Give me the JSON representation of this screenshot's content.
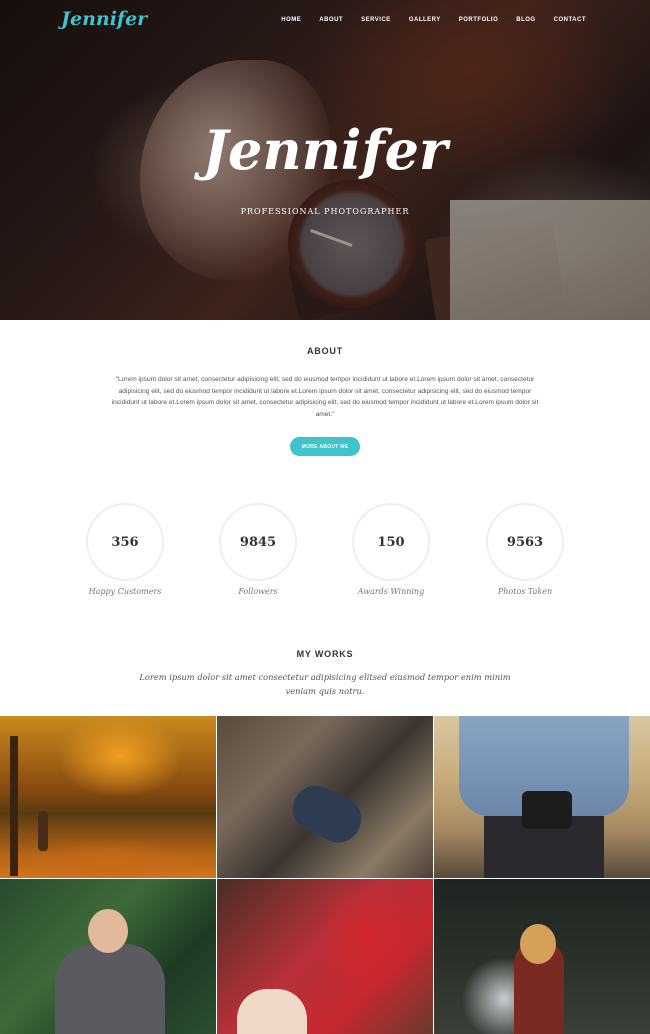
{
  "header": {
    "brand": "Jennifer",
    "nav": [
      "HOME",
      "ABOUT",
      "SERVICE",
      "GALLERY",
      "PORTFOLIO",
      "BLOG",
      "CONTACT"
    ]
  },
  "hero": {
    "title": "Jennifer",
    "subtitle": "PROFESSIONAL PHOTOGRAPHER"
  },
  "about": {
    "title": "ABOUT",
    "text": "\"Lorem ipsum dolor sit amet, consectetur adipisicing elit, sed do eiusmod tempor incididunt ut labore et.Lorem ipsum dolor sit amet, consectetur adipisicing elit, sed do eiusmod tempor incididunt ut labore et.Lorem ipsum dolor sit amet, consectetur adipisicing elit, sed do eiusmod tempor incididunt ut labore et.Lorem ipsum dolor sit amet, consectetur adipisicing elit, sed do eiusmod tempor incididunt ut labore et.Lorem ipsum dolor sit amet.\"",
    "button": "MORE ABOUT ME"
  },
  "stats": [
    {
      "value": "356",
      "label": "Happy Customers"
    },
    {
      "value": "9845",
      "label": "Followers"
    },
    {
      "value": "150",
      "label": "Awards Winning"
    },
    {
      "value": "9563",
      "label": "Photos Taken"
    }
  ],
  "works": {
    "title": "MY WORKS",
    "text": "Lorem ipsum dolor sit amet consectetur adipisicing elitsed eiusmod tempor enim minim veniam quis notru."
  },
  "colors": {
    "accent": "#3fc4cc"
  }
}
